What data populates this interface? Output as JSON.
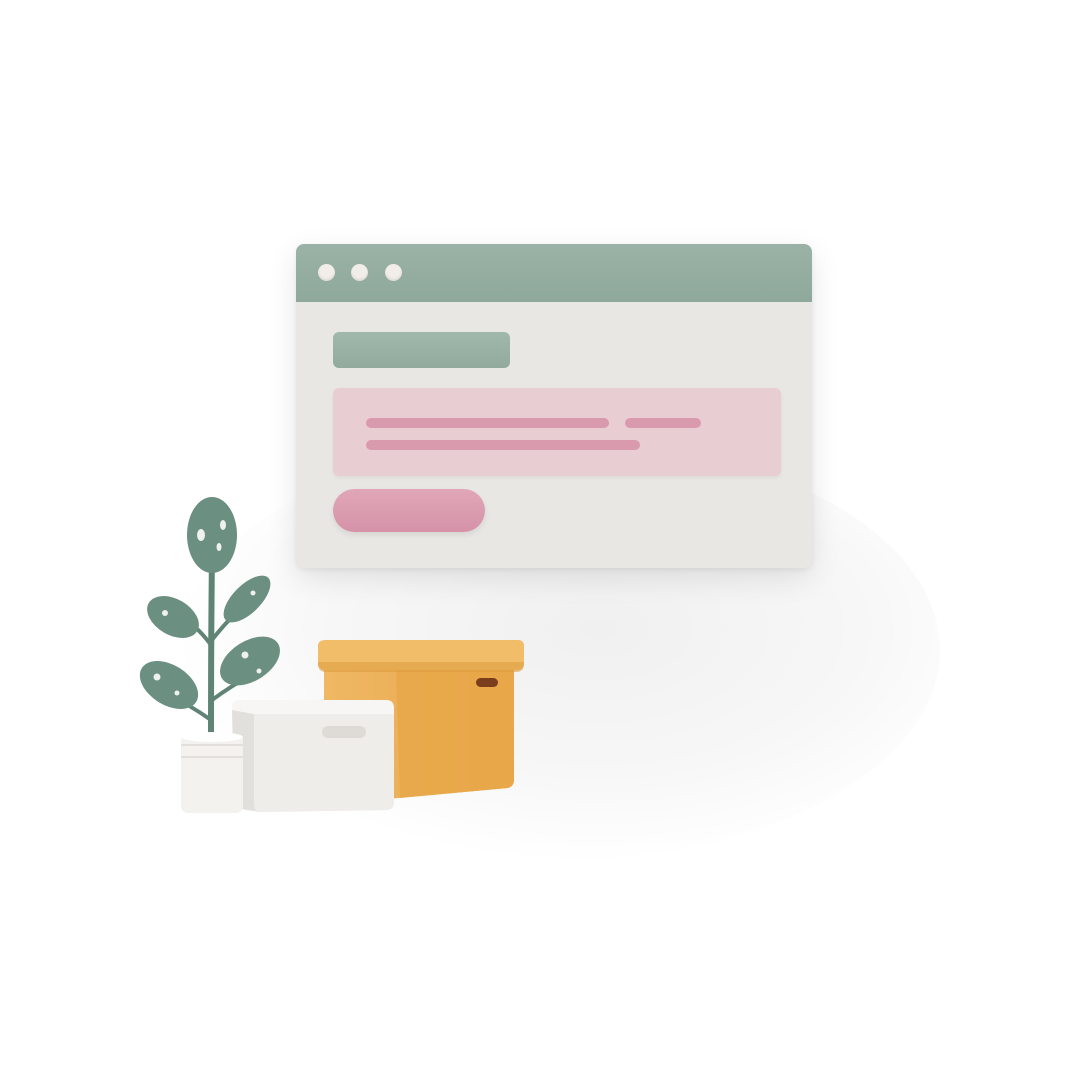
{
  "colors": {
    "title_bar": "#93ab9f",
    "window_body": "#e9e7e3",
    "heading_bar": "#97afa3",
    "content_panel": "#e8cdd2",
    "text_lines": "#d99aad",
    "cta_pill": "#d99aad",
    "orange_box": "#edb35a",
    "white_box": "#efedea",
    "leaf": "#6b8f80"
  },
  "icons": {
    "window_controls": [
      "window-dot-icon",
      "window-dot-icon",
      "window-dot-icon"
    ],
    "plant": "potted-plant-icon",
    "orange_box": "cardboard-box-icon",
    "white_box": "storage-bin-icon"
  }
}
